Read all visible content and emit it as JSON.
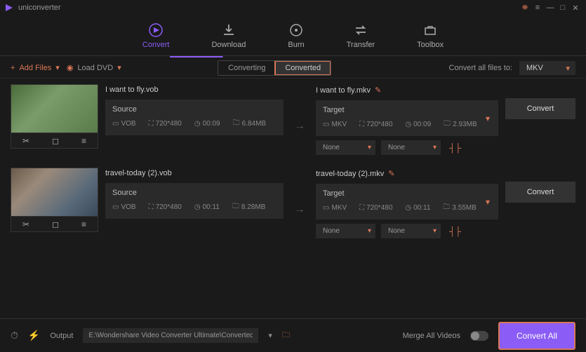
{
  "app": {
    "title": "uniconverter"
  },
  "win": {
    "gift": "⛶",
    "menu": "≡",
    "min": "—",
    "max": "□",
    "close": "✕"
  },
  "tabs": [
    {
      "label": "Convert",
      "active": true
    },
    {
      "label": "Download",
      "active": false
    },
    {
      "label": "Burn",
      "active": false
    },
    {
      "label": "Transfer",
      "active": false
    },
    {
      "label": "Toolbox",
      "active": false
    }
  ],
  "toolbar": {
    "add_files": "Add Files",
    "load_dvd": "Load DVD",
    "seg_converting": "Converting",
    "seg_converted": "Converted",
    "convert_all_label": "Convert all files to:",
    "format": "MKV"
  },
  "files": [
    {
      "name": "I want to fly.vob",
      "source": {
        "label": "Source",
        "fmt": "VOB",
        "res": "720*480",
        "dur": "00:09",
        "size": "6.84MB"
      },
      "target_name": "I want to fly.mkv",
      "target": {
        "label": "Target",
        "fmt": "MKV",
        "res": "720*480",
        "dur": "00:09",
        "size": "2.93MB"
      },
      "dd1": "None",
      "dd2": "None",
      "action": "Convert"
    },
    {
      "name": "travel-today (2).vob",
      "source": {
        "label": "Source",
        "fmt": "VOB",
        "res": "720*480",
        "dur": "00:11",
        "size": "8.28MB"
      },
      "target_name": "travel-today (2).mkv",
      "target": {
        "label": "Target",
        "fmt": "MKV",
        "res": "720*480",
        "dur": "00:11",
        "size": "3.55MB"
      },
      "dd1": "None",
      "dd2": "None",
      "action": "Convert"
    }
  ],
  "bottom": {
    "output_label": "Output",
    "output_path": "E:\\Wondershare Video Converter Ultimate\\Converted",
    "merge_label": "Merge All Videos",
    "convert_all": "Convert All"
  }
}
